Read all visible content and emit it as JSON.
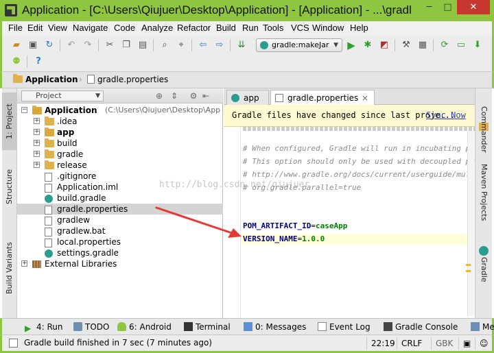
{
  "window": {
    "title": "Application - [C:\\Users\\Qiujuer\\Desktop\\Application] - [Application] - ...\\gradl",
    "min": "─",
    "max": "□",
    "close": "✕"
  },
  "menu": [
    "File",
    "Edit",
    "View",
    "Navigate",
    "Code",
    "Analyze",
    "Refactor",
    "Build",
    "Run",
    "Tools",
    "VCS",
    "Window",
    "Help"
  ],
  "toolbar": {
    "run_config": "gradle:makeJar",
    "help": "?"
  },
  "breadcrumb": {
    "project": "Application",
    "file": "gradle.properties"
  },
  "left_tabs": {
    "project": "1: Project",
    "structure": "Structure",
    "build_variants": "Build Variants"
  },
  "project_panel": {
    "view_mode": "Project",
    "tree": [
      {
        "label": "Application",
        "path": "(C:\\Users\\Qiujuer\\Desktop\\App",
        "type": "module",
        "bold": true
      },
      {
        "label": ".idea",
        "type": "folder"
      },
      {
        "label": "app",
        "type": "module",
        "bold": true
      },
      {
        "label": "build",
        "type": "folder"
      },
      {
        "label": "gradle",
        "type": "folder"
      },
      {
        "label": "release",
        "type": "folder"
      },
      {
        "label": ".gitignore",
        "type": "file"
      },
      {
        "label": "Application.iml",
        "type": "file"
      },
      {
        "label": "build.gradle",
        "type": "gradle"
      },
      {
        "label": "gradle.properties",
        "type": "file",
        "selected": true
      },
      {
        "label": "gradlew",
        "type": "file"
      },
      {
        "label": "gradlew.bat",
        "type": "file"
      },
      {
        "label": "local.properties",
        "type": "file"
      },
      {
        "label": "settings.gradle",
        "type": "gradle"
      },
      {
        "label": "External Libraries",
        "type": "libraries"
      }
    ]
  },
  "editor": {
    "tabs": [
      {
        "label": "app",
        "active": false
      },
      {
        "label": "gradle.properties",
        "active": true,
        "close": "×"
      }
    ],
    "notification": {
      "message": "Gradle files have changed since last proje...",
      "action": "Sync Now"
    },
    "code_lines": [
      {
        "text": "# When configured, Gradle will run in incubating para",
        "kind": "comment"
      },
      {
        "text": "# This option should only be used with decoupled proj",
        "kind": "comment"
      },
      {
        "text": "# http://www.gradle.org/docs/current/userguide/multi_",
        "kind": "comment"
      },
      {
        "text": "# org.gradle.parallel=true",
        "kind": "comment"
      },
      {
        "text": "",
        "kind": "blank"
      },
      {
        "text": "",
        "kind": "blank"
      },
      {
        "key": "POM_ARTIFACT_ID",
        "value": "caseApp",
        "kind": "prop"
      },
      {
        "key": "VERSION_NAME",
        "value": "1.0.0",
        "kind": "prop",
        "current": true
      }
    ]
  },
  "right_tabs": {
    "commander": "Commander",
    "maven": "Maven Projects",
    "gradle": "Gradle"
  },
  "bottom_tools": [
    {
      "label": "4: Run"
    },
    {
      "label": "TODO"
    },
    {
      "label": "6: Android"
    },
    {
      "label": "Terminal"
    },
    {
      "label": "0: Messages"
    },
    {
      "label": "Event Log"
    },
    {
      "label": "Gradle Console"
    },
    {
      "label": "Me"
    }
  ],
  "status": {
    "message": "Gradle build finished in 7 sec (7 minutes ago)",
    "position": "22:19",
    "line_sep": "CRLF ÷",
    "encoding": "GBK"
  },
  "watermark": "http://blog.csdn.net/qiujuer",
  "colors": {
    "window_accent": "#8ec63f",
    "notification_bg": "#fffad2",
    "arrow": "#e53935"
  }
}
